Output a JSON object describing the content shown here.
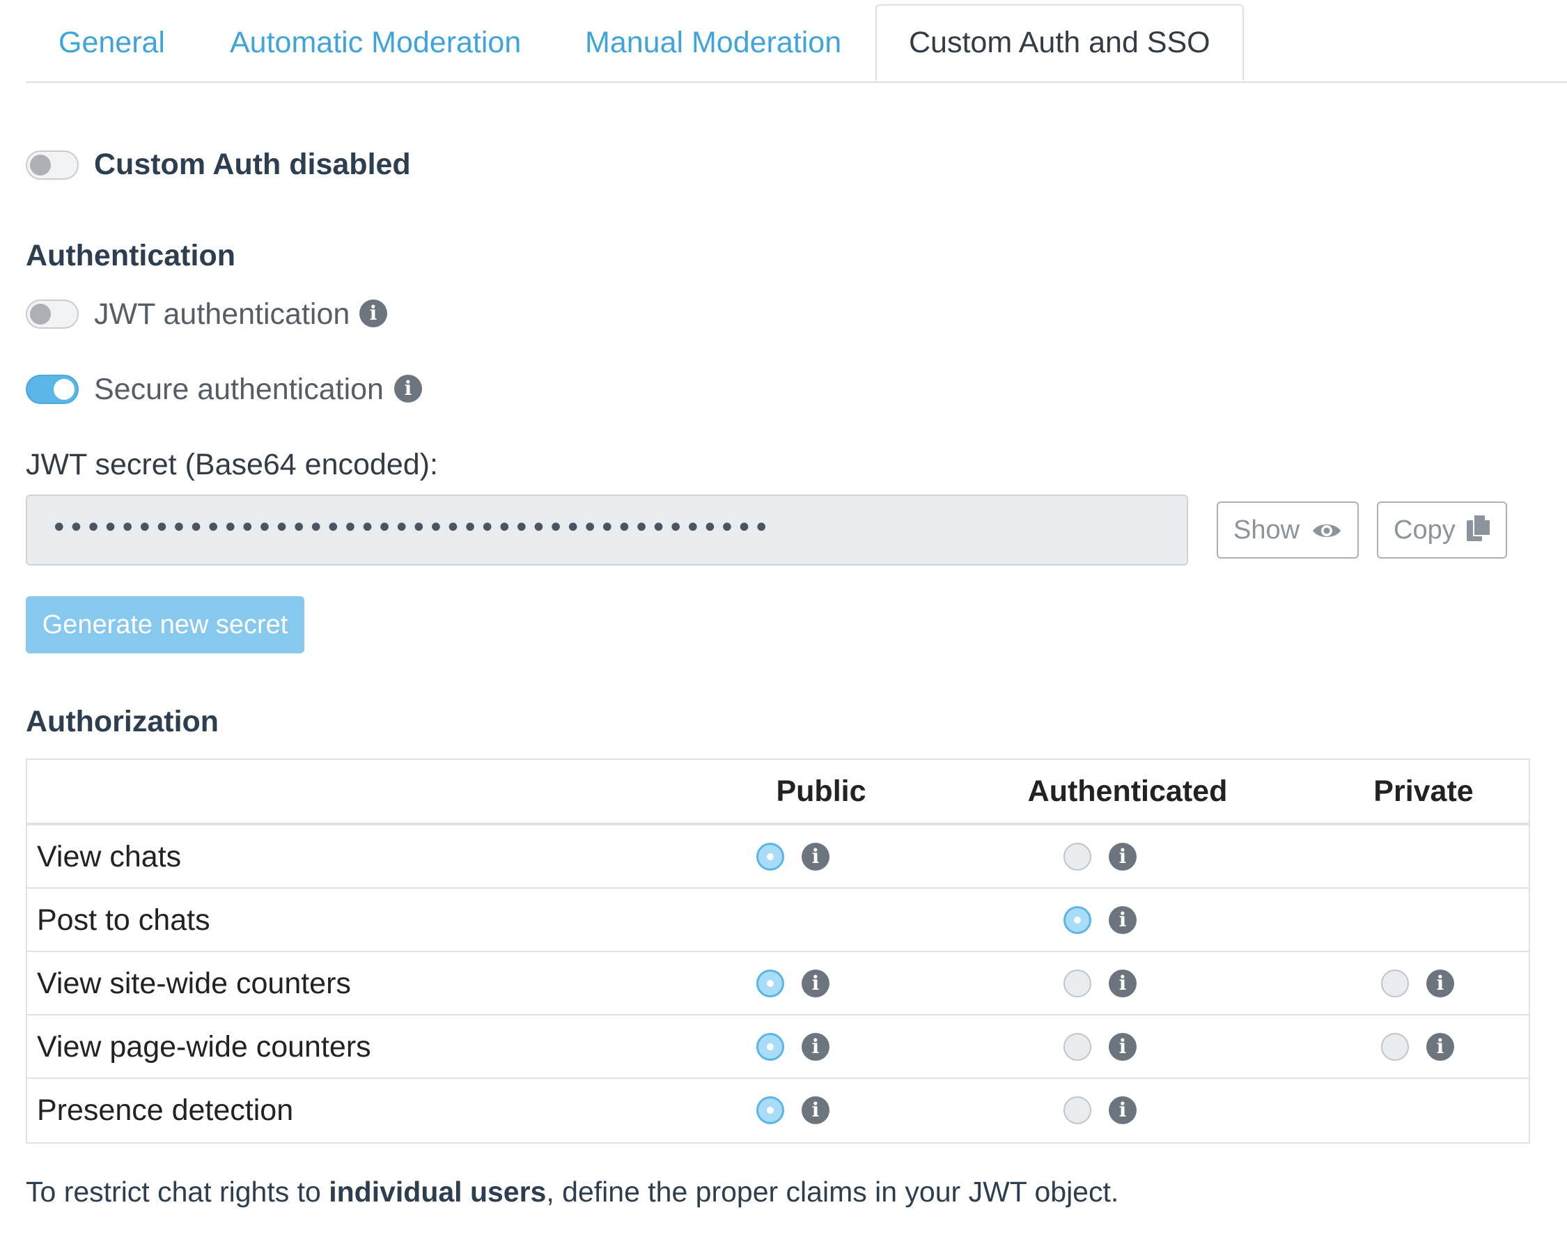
{
  "tabs": [
    {
      "label": "General",
      "active": false
    },
    {
      "label": "Automatic Moderation",
      "active": false
    },
    {
      "label": "Manual Moderation",
      "active": false
    },
    {
      "label": "Custom Auth and SSO",
      "active": true
    }
  ],
  "custom_auth": {
    "label": "Custom Auth disabled",
    "enabled": false
  },
  "authentication": {
    "heading": "Authentication",
    "jwt": {
      "label": "JWT authentication",
      "enabled": false
    },
    "secure": {
      "label": "Secure authentication",
      "enabled": true
    },
    "secret_label": "JWT secret (Base64 encoded):",
    "secret_value": "••••••••••••••••••••••••••••••••••••••••••",
    "show_label": "Show",
    "copy_label": "Copy",
    "generate_label": "Generate new secret"
  },
  "authorization": {
    "heading": "Authorization",
    "columns": [
      "Public",
      "Authenticated",
      "Private"
    ],
    "rows": [
      {
        "label": "View chats",
        "public": "selected",
        "authenticated": "unselected",
        "private": null
      },
      {
        "label": "Post to chats",
        "public": null,
        "authenticated": "selected",
        "private": null
      },
      {
        "label": "View site-wide counters",
        "public": "selected",
        "authenticated": "unselected",
        "private": "unselected"
      },
      {
        "label": "View page-wide counters",
        "public": "selected",
        "authenticated": "unselected",
        "private": "unselected"
      },
      {
        "label": "Presence detection",
        "public": "selected",
        "authenticated": "unselected",
        "private": null
      }
    ]
  },
  "footnote": {
    "before": "To restrict chat rights to ",
    "bold": "individual users",
    "after": ", define the proper claims in your JWT object."
  },
  "colors": {
    "accent": "#3fa4dc",
    "toggle_on": "#5bb6e8",
    "primary_button": "#86c8ee"
  },
  "icons": {
    "info": "info-circle-icon",
    "show": "eye-icon",
    "copy": "copy-icon"
  }
}
